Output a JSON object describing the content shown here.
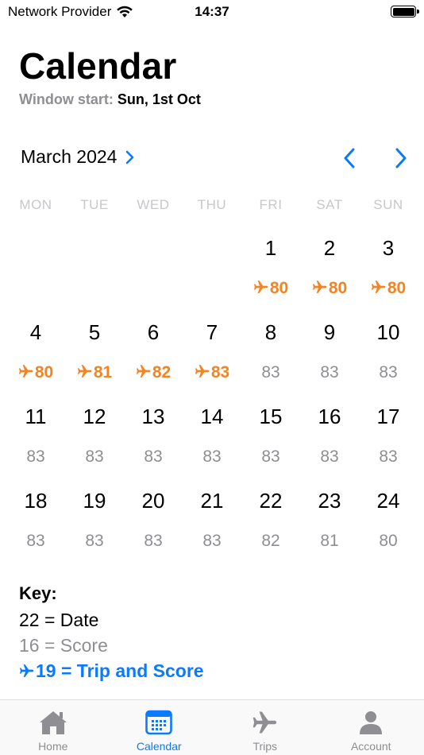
{
  "status_bar": {
    "carrier": "Network Provider",
    "time": "14:37"
  },
  "header": {
    "title": "Calendar",
    "window_start_label": "Window start:",
    "window_start_value": "Sun, 1st Oct"
  },
  "month": {
    "label": "March 2024"
  },
  "weekdays": [
    "MON",
    "TUE",
    "WED",
    "THU",
    "FRI",
    "SAT",
    "SUN"
  ],
  "days": [
    {
      "date": "",
      "score": ""
    },
    {
      "date": "",
      "score": ""
    },
    {
      "date": "",
      "score": ""
    },
    {
      "date": "",
      "score": ""
    },
    {
      "date": "1",
      "score": "80",
      "trip": true
    },
    {
      "date": "2",
      "score": "80",
      "trip": true
    },
    {
      "date": "3",
      "score": "80",
      "trip": true
    },
    {
      "date": "4",
      "score": "80",
      "trip": true
    },
    {
      "date": "5",
      "score": "81",
      "trip": true
    },
    {
      "date": "6",
      "score": "82",
      "trip": true
    },
    {
      "date": "7",
      "score": "83",
      "trip": true
    },
    {
      "date": "8",
      "score": "83",
      "trip": false
    },
    {
      "date": "9",
      "score": "83",
      "trip": false
    },
    {
      "date": "10",
      "score": "83",
      "trip": false
    },
    {
      "date": "11",
      "score": "83",
      "trip": false
    },
    {
      "date": "12",
      "score": "83",
      "trip": false
    },
    {
      "date": "13",
      "score": "83",
      "trip": false
    },
    {
      "date": "14",
      "score": "83",
      "trip": false
    },
    {
      "date": "15",
      "score": "83",
      "trip": false
    },
    {
      "date": "16",
      "score": "83",
      "trip": false
    },
    {
      "date": "17",
      "score": "83",
      "trip": false
    },
    {
      "date": "18",
      "score": "83",
      "trip": false
    },
    {
      "date": "19",
      "score": "83",
      "trip": false
    },
    {
      "date": "20",
      "score": "83",
      "trip": false
    },
    {
      "date": "21",
      "score": "83",
      "trip": false
    },
    {
      "date": "22",
      "score": "82",
      "trip": false
    },
    {
      "date": "23",
      "score": "81",
      "trip": false
    },
    {
      "date": "24",
      "score": "80",
      "trip": false
    }
  ],
  "key": {
    "title": "Key:",
    "date_line": "22 = Date",
    "score_line": "16 = Score",
    "trip_line": "19 = Trip and Score"
  },
  "tabs": [
    {
      "label": "Home",
      "icon": "house-icon",
      "active": false
    },
    {
      "label": "Calendar",
      "icon": "calendar-icon",
      "active": true
    },
    {
      "label": "Trips",
      "icon": "airplane-icon",
      "active": false
    },
    {
      "label": "Account",
      "icon": "person-icon",
      "active": false
    }
  ],
  "colors": {
    "accent": "#0a7aff",
    "trip": "#f5831f",
    "muted": "#8e8e93",
    "weekday": "#c7c7cc"
  }
}
